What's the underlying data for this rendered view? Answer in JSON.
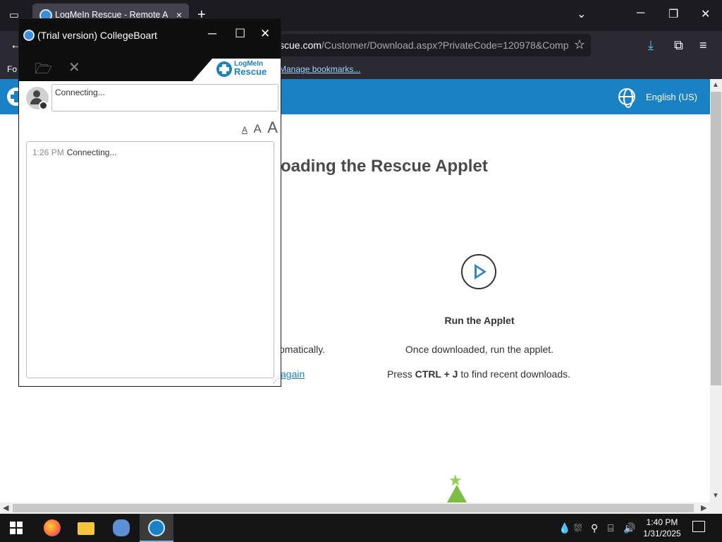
{
  "browser": {
    "tab_title": "LogMeIn Rescue - Remote Acc",
    "tab_close": "×",
    "new_tab": "+",
    "url_main": "scue.com",
    "url_rest": "/Customer/Download.aspx?PrivateCode=120978&Comp",
    "bookmarks_left": "Fo",
    "bookmarks_manage": "Manage bookmarks..."
  },
  "page": {
    "title_partial": "oading the Rescue Applet",
    "language": "English (US)",
    "run_title": "Run the Applet",
    "run_desc": "Once downloaded, run the applet.",
    "run_hint_pre": "Press ",
    "run_hint_keys": "CTRL + J",
    "run_hint_post": " to find recent downloads.",
    "left_partial": "omatically.",
    "left_link": "again"
  },
  "rescue": {
    "title": "(Trial version) CollegeBoart",
    "logo_top": "LogMeIn",
    "logo_bottom": "Rescue",
    "input_value": "Connecting...",
    "font_small": "A",
    "font_medium": "A",
    "font_large": "A",
    "log": [
      {
        "time": "1:26 PM",
        "message": "Connecting..."
      }
    ]
  },
  "taskbar": {
    "time": "1:40 PM",
    "date": "1/31/2025"
  },
  "colors": {
    "accent": "#1a82c4",
    "chrome_dark": "#1c1b22"
  }
}
